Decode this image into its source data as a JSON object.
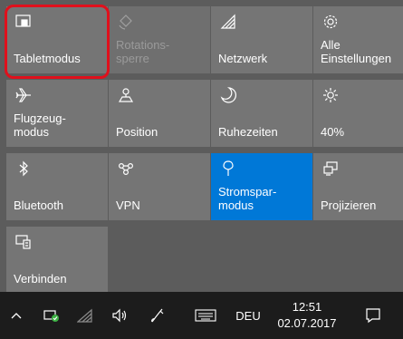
{
  "tiles": [
    {
      "label": "Tabletmodus",
      "icon": "tablet-mode-icon",
      "state": "normal"
    },
    {
      "label": "Rotations-\nsperre",
      "icon": "rotation-lock-icon",
      "state": "disabled"
    },
    {
      "label": "Netzwerk",
      "icon": "network-icon",
      "state": "normal"
    },
    {
      "label": "Alle\nEinstellungen",
      "icon": "gear-icon",
      "state": "normal"
    },
    {
      "label": "Flugzeug-\nmodus",
      "icon": "airplane-icon",
      "state": "normal"
    },
    {
      "label": "Position",
      "icon": "location-icon",
      "state": "normal"
    },
    {
      "label": "Ruhezeiten",
      "icon": "moon-icon",
      "state": "normal"
    },
    {
      "label": "40%",
      "icon": "brightness-icon",
      "state": "normal"
    },
    {
      "label": "Bluetooth",
      "icon": "bluetooth-icon",
      "state": "normal"
    },
    {
      "label": "VPN",
      "icon": "vpn-icon",
      "state": "normal"
    },
    {
      "label": "Stromspar-\nmodus",
      "icon": "battery-saver-icon",
      "state": "active"
    },
    {
      "label": "Projizieren",
      "icon": "project-icon",
      "state": "normal"
    },
    {
      "label": "Verbinden",
      "icon": "connect-icon",
      "state": "normal"
    }
  ],
  "taskbar": {
    "language": "DEU",
    "time": "12:51",
    "date": "02.07.2017"
  },
  "colors": {
    "tile": "#757575",
    "active_tile": "#0078d7",
    "highlight": "#e0101c",
    "taskbar": "#1c1c1c"
  }
}
